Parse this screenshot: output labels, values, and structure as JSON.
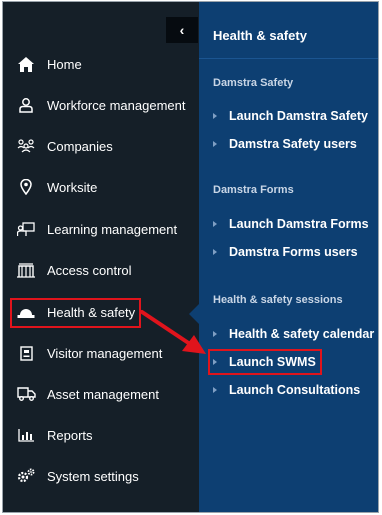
{
  "sidebar": {
    "collapse_glyph": "‹",
    "items": [
      {
        "label": "Home",
        "icon": "home-icon"
      },
      {
        "label": "Workforce management",
        "icon": "person-icon"
      },
      {
        "label": "Companies",
        "icon": "people-group-icon"
      },
      {
        "label": "Worksite",
        "icon": "location-pin-icon"
      },
      {
        "label": "Learning management",
        "icon": "learning-screen-icon"
      },
      {
        "label": "Access control",
        "icon": "gate-icon"
      },
      {
        "label": "Health & safety",
        "icon": "hard-hat-icon"
      },
      {
        "label": "Visitor management",
        "icon": "id-badge-icon"
      },
      {
        "label": "Asset management",
        "icon": "truck-icon"
      },
      {
        "label": "Reports",
        "icon": "bar-chart-icon"
      },
      {
        "label": "System settings",
        "icon": "gears-icon"
      }
    ]
  },
  "submenu": {
    "title": "Health & safety",
    "sections": [
      {
        "heading": "Damstra Safety",
        "items": [
          "Launch Damstra Safety",
          "Damstra Safety users"
        ]
      },
      {
        "heading": "Damstra Forms",
        "items": [
          "Launch Damstra Forms",
          "Damstra Forms users"
        ]
      },
      {
        "heading": "Health & safety sessions",
        "items": [
          "Health & safety calendar",
          "Launch SWMS",
          "Launch Consultations"
        ]
      }
    ]
  },
  "colors": {
    "sidebar_bg": "#151f28",
    "submenu_bg": "#0d3f72",
    "annotation_red": "#e0141c"
  }
}
